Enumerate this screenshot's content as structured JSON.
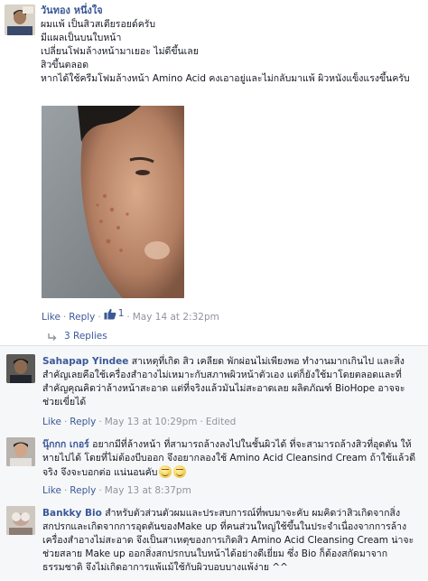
{
  "post": {
    "author": "วันทอง หนึ่งใจ",
    "lines": [
      "ผมแพ้ เป็นสิวสเตียรอยด์ครับ",
      "มีแผลเป็นบนใบหน้า",
      "เปลี่ยนโฟมล้างหน้ามาเยอะ ไม่ดีขึ้นเลย",
      "สิวขึ้นตลอด",
      "หากได้ใช้ครีมโฟมล้างหน้า Amino Acid คงเอาอยู่และไม่กลับมาแพ้ ผิวหนังแข็งแรงขึ้นครับ"
    ],
    "like_label": "Like",
    "reply_label": "Reply",
    "like_count": "1",
    "timestamp": "May 14 at 2:32pm",
    "replies_label": "3 Replies"
  },
  "comments": [
    {
      "author": "Sahapap Yindee",
      "text": "สาเหตุที่เกิด สิว เคลียด พักผ่อนไม่เพียงพอ ทำงานมากเกินไป และสิ่งสำคัญเลยคือใช้เครื่องสำอางไม่เหมาะกับสภาพผิวหน้าตัวเอง แต่ก็ยังใช้มาโดยตลอดและที่สำคัญคุณคิดว่าล้างหน้าสะอาด แต่ที่จริงแล้วมันไม่สะอาดเลย ผลิตภัณฑ์ BioHope อาจจะช่วยเขี่ยได้",
      "like_label": "Like",
      "reply_label": "Reply",
      "timestamp": "May 13 at 10:29pm",
      "edited_label": "Edited"
    },
    {
      "author": "นุ๊กกก เกอร์",
      "text": "อยากมีที่ล้างหน้า ที่สามารถล้างลงไปในชั้นผิวได้ ที่จะสามารถล้างสิวที่อุดตัน ให้หายไปได้ โดยที่ไม่ต้องบีบออก จึงอยากลองใช้ Amino Acid Cleansind Cream ถ้าใช้แล้วดีจริง จึงจะบอกต่อ แน่นอนคับ",
      "like_label": "Like",
      "reply_label": "Reply",
      "timestamp": "May 13 at 8:37pm"
    },
    {
      "author": "Bankky Bio",
      "text": "สำหรับตัวส่วนตัวผมและประสบการณ์ที่พบมาจะคับ ผมคิดว่าสิวเกิดจากสิ่งสกปรกและเกิดจากการอุดตันของMake up ที่คนส่วนใหญ่ใช้ขึ้นในประจำเนื่องจากการล้างเครื่องสำอางไม่สะอาด จึงเป็นสาเหตุของการเกิดสิว Amino Acid Cleansing Cream น่าจะช่วยสลาย Make up ออกสิ่งสกปรกบนใบหน้าได้อย่างดีเยี่ยม ซึ่ง Bio ก็ต้องสกัดมาจากธรรมชาติ จึงไม่เกิดอาการแพ้แม้ใช้กับผิวบอบบางแพ้ง่าย ^^"
    }
  ],
  "colors": {
    "link": "#3b5998",
    "meta": "#90949c",
    "comment_bg": "#f6f7f9"
  }
}
